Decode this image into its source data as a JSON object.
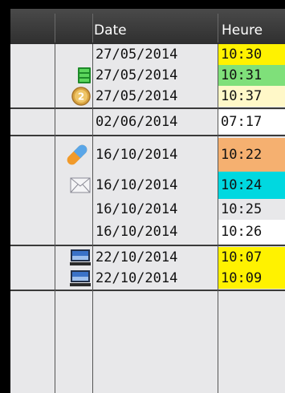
{
  "header": {
    "date_label": "Date",
    "heure_label": "Heure"
  },
  "colors": {
    "yellow": "#fff200",
    "green": "#7fe07a",
    "light_yellow": "#fff8c8",
    "white": "#ffffff",
    "orange": "#f5b070",
    "cyan": "#00d8e0",
    "gray": "#e8e8ea"
  },
  "groups": [
    {
      "rows": [
        {
          "date": "27/05/2014",
          "heure": "10:30",
          "icon": "",
          "color": "#fff200"
        },
        {
          "date": "27/05/2014",
          "heure": "10:31",
          "icon": "green-list-icon",
          "color": "#7fe07a"
        },
        {
          "date": "27/05/2014",
          "heure": "10:37",
          "icon": "gold-coin-2-icon",
          "color": "#fff8c8"
        }
      ]
    },
    {
      "rows": [
        {
          "date": "02/06/2014",
          "heure": "07:17",
          "icon": "",
          "color": "#ffffff"
        }
      ]
    },
    {
      "rows": [
        {
          "date": "16/10/2014",
          "heure": "10:22",
          "icon": "pill-icon",
          "color": "#f5b070"
        },
        {
          "date": "16/10/2014",
          "heure": "10:24",
          "icon": "envelope-icon",
          "color": "#00d8e0"
        },
        {
          "date": "16/10/2014",
          "heure": "10:25",
          "icon": "",
          "color": "#e8e8ea"
        },
        {
          "date": "16/10/2014",
          "heure": "10:26",
          "icon": "",
          "color": "#ffffff"
        }
      ]
    },
    {
      "rows": [
        {
          "date": "22/10/2014",
          "heure": "10:07",
          "icon": "monitor-icon",
          "color": "#fff200"
        },
        {
          "date": "22/10/2014",
          "heure": "10:09",
          "icon": "monitor-icon",
          "color": "#fff200"
        }
      ]
    }
  ]
}
